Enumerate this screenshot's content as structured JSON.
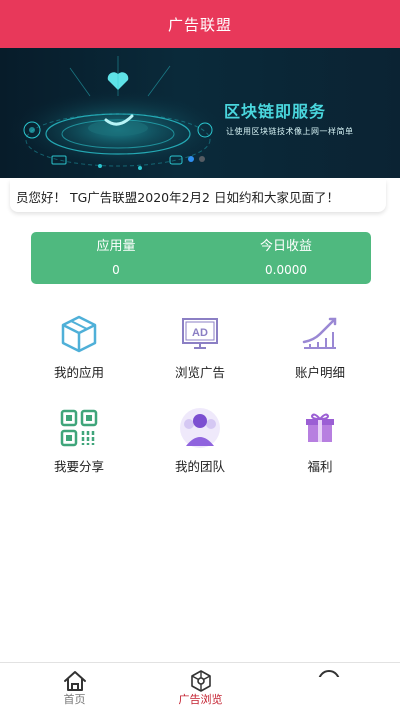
{
  "header": {
    "title": "广告联盟"
  },
  "banner": {
    "title": "区块链即服务",
    "subtitle": "让使用区块链技术像上网一样简单",
    "colors": {
      "accent": "#4ad7de",
      "background": "#071c2a"
    }
  },
  "notice": {
    "text": "员您好！ TG广告联盟2020年2月2 日如约和大家见面了！"
  },
  "stats": {
    "items": [
      {
        "label": "应用量",
        "value": "0"
      },
      {
        "label": "今日收益",
        "value": "0.0000"
      }
    ],
    "color": "#4fb97f"
  },
  "menu": {
    "items": [
      {
        "label": "我的应用",
        "icon": "cube-icon"
      },
      {
        "label": "浏览广告",
        "icon": "ad-screen-icon"
      },
      {
        "label": "账户明细",
        "icon": "chart-line-icon"
      },
      {
        "label": "我要分享",
        "icon": "qr-code-icon"
      },
      {
        "label": "我的团队",
        "icon": "team-icon"
      },
      {
        "label": "福利",
        "icon": "gift-icon"
      }
    ]
  },
  "tabbar": {
    "items": [
      {
        "label": "首页",
        "icon": "home-icon",
        "active": false
      },
      {
        "label": "广告浏览",
        "icon": "network-icon",
        "active": true
      },
      {
        "label": "",
        "icon": "smile-icon",
        "active": false
      }
    ],
    "active_color": "#c3202f"
  },
  "colors": {
    "brand": "#e8385a"
  }
}
